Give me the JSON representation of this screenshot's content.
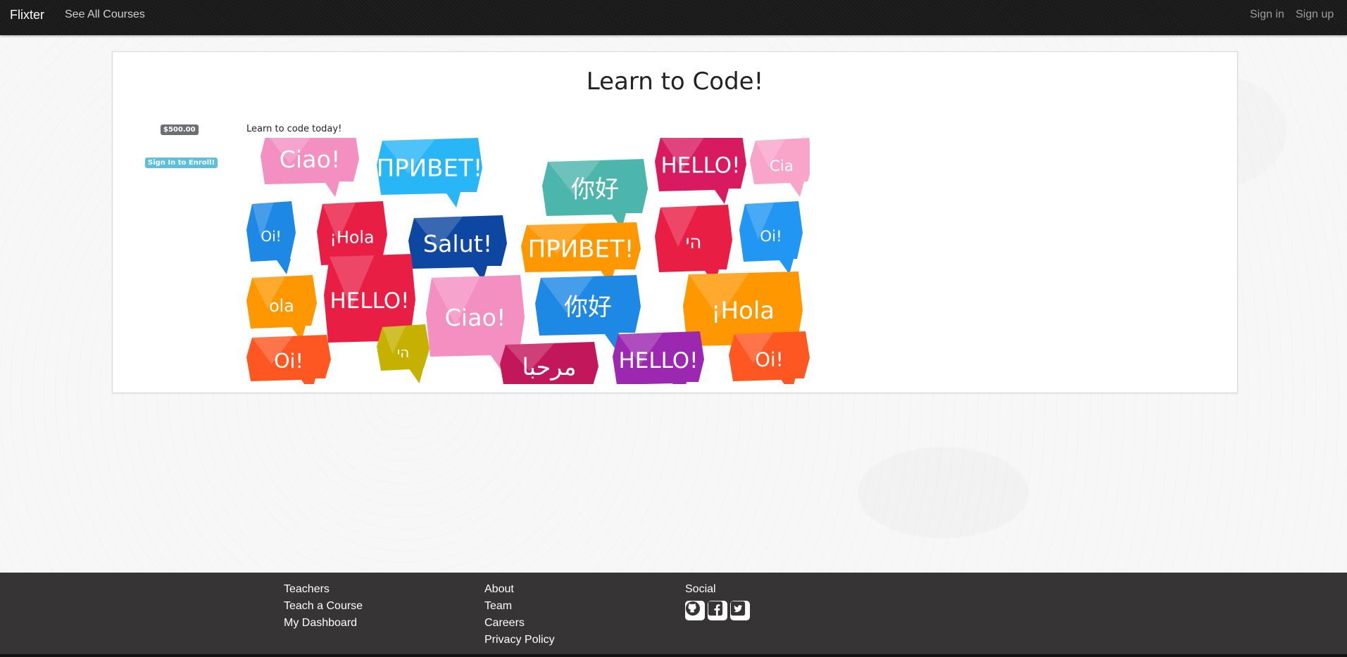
{
  "navbar": {
    "brand": "Flixter",
    "see_all_courses": "See All Courses",
    "sign_in": "Sign in",
    "sign_up": "Sign up"
  },
  "course": {
    "title": "Learn to Code!",
    "price": "$500.00",
    "enroll_label": "Sign In to Enroll!",
    "description": "Learn to code today!",
    "image_bubbles": [
      {
        "text": "Ciao!",
        "color": "#f48fc2"
      },
      {
        "text": "ПРИВЕТ!",
        "color": "#29b6f6"
      },
      {
        "text": "你好",
        "color": "#4db6ac"
      },
      {
        "text": "HELLO!",
        "color": "#d81b60"
      },
      {
        "text": "Cia",
        "color": "#f8a5c9"
      },
      {
        "text": "Oi!",
        "color": "#1e88e5"
      },
      {
        "text": "¡Hola",
        "color": "#e91e45"
      },
      {
        "text": "Salut!",
        "color": "#0d47a1"
      },
      {
        "text": "ПРИВЕТ!",
        "color": "#ff9800"
      },
      {
        "text": "הי",
        "color": "#e91e45"
      },
      {
        "text": "Oi!",
        "color": "#2196f3"
      },
      {
        "text": "ola",
        "color": "#ff9800"
      },
      {
        "text": "HELLO!",
        "color": "#e91e45"
      },
      {
        "text": "Ciao!",
        "color": "#f48fc2"
      },
      {
        "text": "你好",
        "color": "#1e88e5"
      },
      {
        "text": "¡Hola",
        "color": "#ff9800"
      },
      {
        "text": "Oi!",
        "color": "#ff5722"
      },
      {
        "text": "הי",
        "color": "#c6b100"
      },
      {
        "text": "مرحبا",
        "color": "#c2185b"
      },
      {
        "text": "HELLO!",
        "color": "#9c27b0"
      },
      {
        "text": "Oi!",
        "color": "#ff5722"
      }
    ]
  },
  "footer": {
    "col1": [
      "Teachers",
      "Teach a Course",
      "My Dashboard"
    ],
    "col2": [
      "About",
      "Team",
      "Careers",
      "Privacy Policy"
    ],
    "social_heading": "Social",
    "social_icons": [
      "github-icon",
      "facebook-icon",
      "twitter-icon"
    ]
  }
}
